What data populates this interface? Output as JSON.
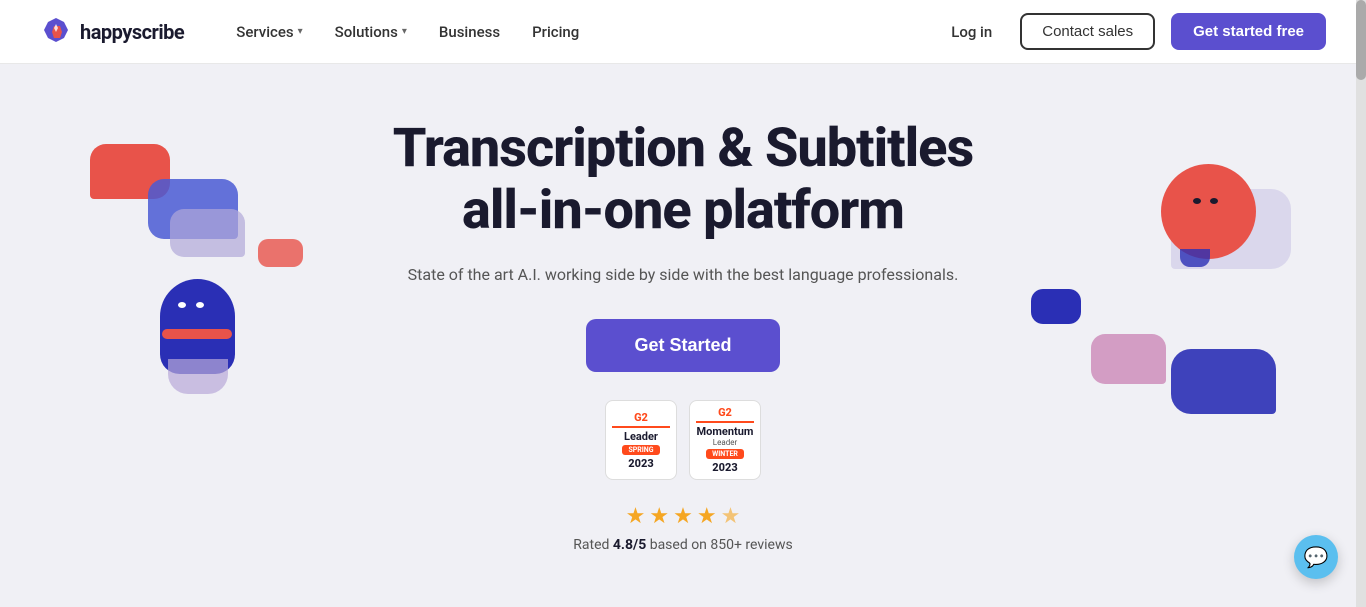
{
  "nav": {
    "logo_text": "happyscribe",
    "services_label": "Services",
    "solutions_label": "Solutions",
    "business_label": "Business",
    "pricing_label": "Pricing",
    "login_label": "Log in",
    "contact_label": "Contact sales",
    "get_started_label": "Get started free"
  },
  "hero": {
    "title_line1": "Transcription & Subtitles",
    "title_line2": "all-in-one platform",
    "subtitle": "State of the art A.I. working side by side with the best language professionals.",
    "cta_label": "Get Started",
    "badge1": {
      "g2": "G2",
      "title": "Leader",
      "season": "SPRING",
      "year": "2023"
    },
    "badge2": {
      "g2": "G2",
      "title": "Momentum",
      "title2": "Leader",
      "season": "WINTER",
      "year": "2023"
    },
    "rating_text": "Rated ",
    "rating_value": "4.8/5",
    "rating_suffix": " based on 850+ reviews"
  },
  "colors": {
    "purple": "#5b4fcf",
    "red": "#e8534a",
    "blue": "#2a2fb5",
    "light_blue": "#5bbfef"
  }
}
